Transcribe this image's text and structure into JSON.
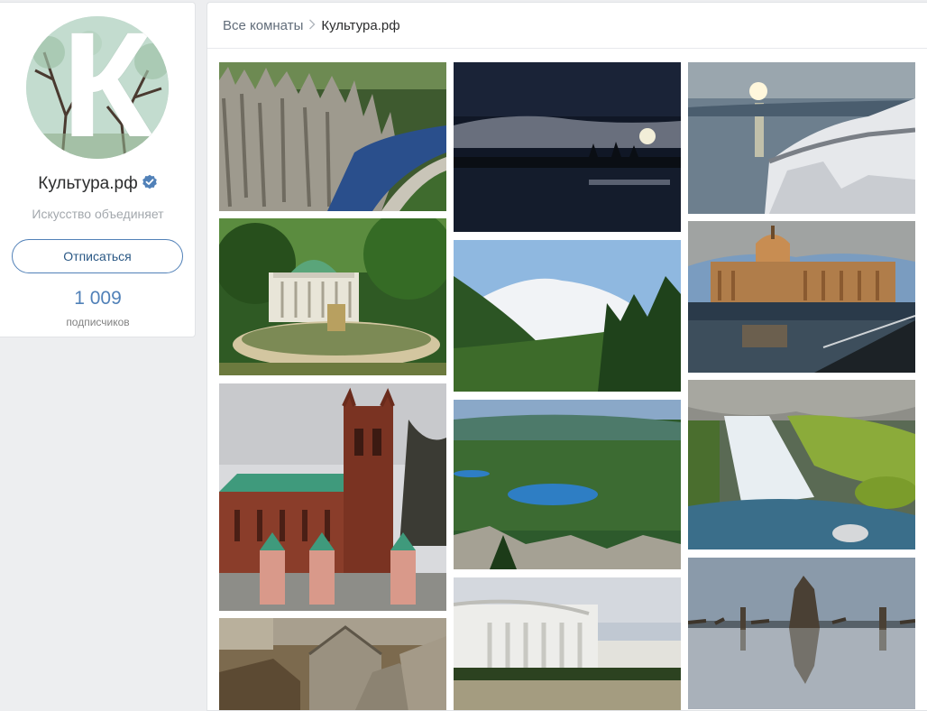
{
  "profile": {
    "name": "Культура.рф",
    "subtitle": "Искусство объединяет",
    "avatar_letter": "К",
    "button_label": "Отписаться",
    "subscribers_count": "1 009",
    "subscribers_label": "подписчиков",
    "verified_icon": "verified-check-icon",
    "accent_color": "#5181b8"
  },
  "breadcrumb": {
    "root": "Все комнаты",
    "separator_icon": "chevron-right-icon",
    "current": "Культура.рф"
  },
  "gallery": {
    "photos": [
      {
        "name": "photo-lena-pillars"
      },
      {
        "name": "photo-night-lake"
      },
      {
        "name": "photo-sea-cliff-sunset"
      },
      {
        "name": "photo-pavilion-fountain"
      },
      {
        "name": "photo-snowy-mountain"
      },
      {
        "name": "photo-kazan-cathedral"
      },
      {
        "name": "photo-brick-church"
      },
      {
        "name": "photo-mountain-lake"
      },
      {
        "name": "photo-waterfall"
      },
      {
        "name": "photo-stone-crypts"
      },
      {
        "name": "photo-colonnade-palace"
      },
      {
        "name": "photo-tree-stumps-lake"
      }
    ]
  }
}
